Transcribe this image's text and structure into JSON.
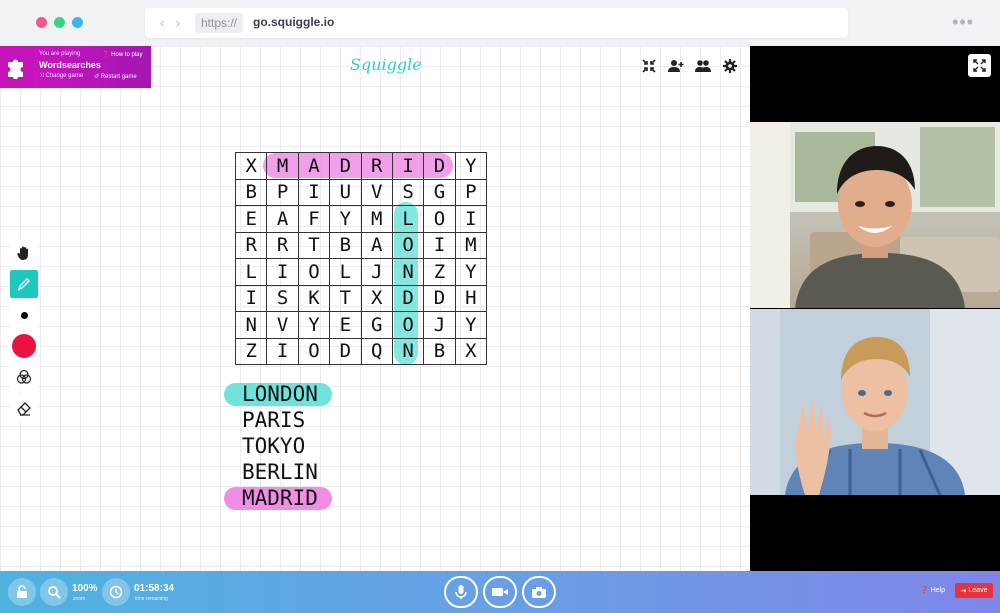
{
  "browser": {
    "protocol": "https://",
    "domain": "go.squiggle.io"
  },
  "game": {
    "playing_label": "You are playing",
    "name": "Wordsearches",
    "how_to_play": "How to play",
    "change_game": "Change game",
    "restart_game": "Restart game"
  },
  "app": {
    "logo": "Squiggle",
    "accent_color": "#1fc8bd"
  },
  "grid": {
    "rows": [
      [
        "X",
        "M",
        "A",
        "D",
        "R",
        "I",
        "D",
        "Y"
      ],
      [
        "B",
        "P",
        "I",
        "U",
        "V",
        "S",
        "G",
        "P"
      ],
      [
        "E",
        "A",
        "F",
        "Y",
        "M",
        "L",
        "O",
        "I"
      ],
      [
        "R",
        "R",
        "T",
        "B",
        "A",
        "O",
        "I",
        "M"
      ],
      [
        "L",
        "I",
        "O",
        "L",
        "J",
        "N",
        "Z",
        "Y"
      ],
      [
        "I",
        "S",
        "K",
        "T",
        "X",
        "D",
        "D",
        "H"
      ],
      [
        "N",
        "V",
        "Y",
        "E",
        "G",
        "O",
        "J",
        "Y"
      ],
      [
        "Z",
        "I",
        "O",
        "D",
        "Q",
        "N",
        "B",
        "X"
      ]
    ],
    "found_colors": {
      "madrid": "#f08ee6",
      "london": "#6fe3da"
    }
  },
  "words": [
    {
      "text": "LONDON",
      "found": true,
      "color": "#6fe3da"
    },
    {
      "text": "PARIS",
      "found": false,
      "color": ""
    },
    {
      "text": "TOKYO",
      "found": false,
      "color": ""
    },
    {
      "text": "BERLIN",
      "found": false,
      "color": ""
    },
    {
      "text": "MADRID",
      "found": true,
      "color": "#f08ee6"
    }
  ],
  "toolbar": {
    "selected_color": "#e8133f",
    "brush_color": "#000000"
  },
  "status": {
    "zoom_value": "100%",
    "zoom_label": "zoom",
    "time_value": "01:58:34",
    "time_label": "time remaining"
  },
  "footer": {
    "help": "Help",
    "leave": "Leave"
  }
}
